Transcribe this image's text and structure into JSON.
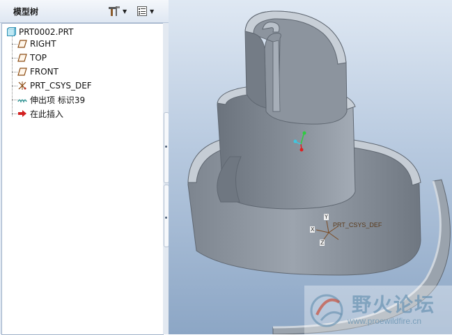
{
  "model_tree": {
    "title": "模型树",
    "root": "PRT0002.PRT",
    "items": [
      {
        "label": "RIGHT",
        "icon": "datum-plane-icon"
      },
      {
        "label": "TOP",
        "icon": "datum-plane-icon"
      },
      {
        "label": "FRONT",
        "icon": "datum-plane-icon"
      },
      {
        "label": "PRT_CSYS_DEF",
        "icon": "coordinate-system-icon"
      },
      {
        "label": "伸出项 标识39",
        "icon": "protrusion-feature-icon"
      },
      {
        "label": "在此插入",
        "icon": "insert-here-arrow-icon"
      }
    ]
  },
  "toolbar": {
    "settings_icon": "tree-settings-icon",
    "columns_icon": "tree-columns-icon"
  },
  "viewport": {
    "csys_label": "PRT_CSYS_DEF",
    "axis_labels": {
      "x": "X",
      "y": "Y",
      "z": "Z"
    },
    "colors": {
      "model": "#8f98a3",
      "model_light": "#c3cbd4",
      "model_dark": "#6b737d"
    }
  },
  "watermark": {
    "title": "野火论坛",
    "url": "www.proewildfire.cn"
  }
}
